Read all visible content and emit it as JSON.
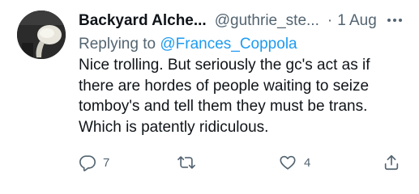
{
  "tweet": {
    "display_name": "Backyard Alche...",
    "handle": "@guthrie_ste...",
    "separator": "·",
    "date": "1 Aug",
    "replying_prefix": "Replying to ",
    "replying_to": "@Frances_Coppola",
    "body_lines": [
      "Nice trolling.  But seriously  the gc's act as if",
      "there are hordes of people waiting to seize",
      "tomboy's and tell them they must be trans.",
      "Which is patently ridiculous."
    ]
  },
  "actions": {
    "reply": {
      "icon": "reply-icon",
      "count": "7"
    },
    "retweet": {
      "icon": "retweet-icon",
      "count": ""
    },
    "like": {
      "icon": "heart-icon",
      "count": "4"
    },
    "share": {
      "icon": "share-icon"
    }
  },
  "colors": {
    "text": "#0f1419",
    "secondary": "#536471",
    "link": "#1d9bf0"
  }
}
